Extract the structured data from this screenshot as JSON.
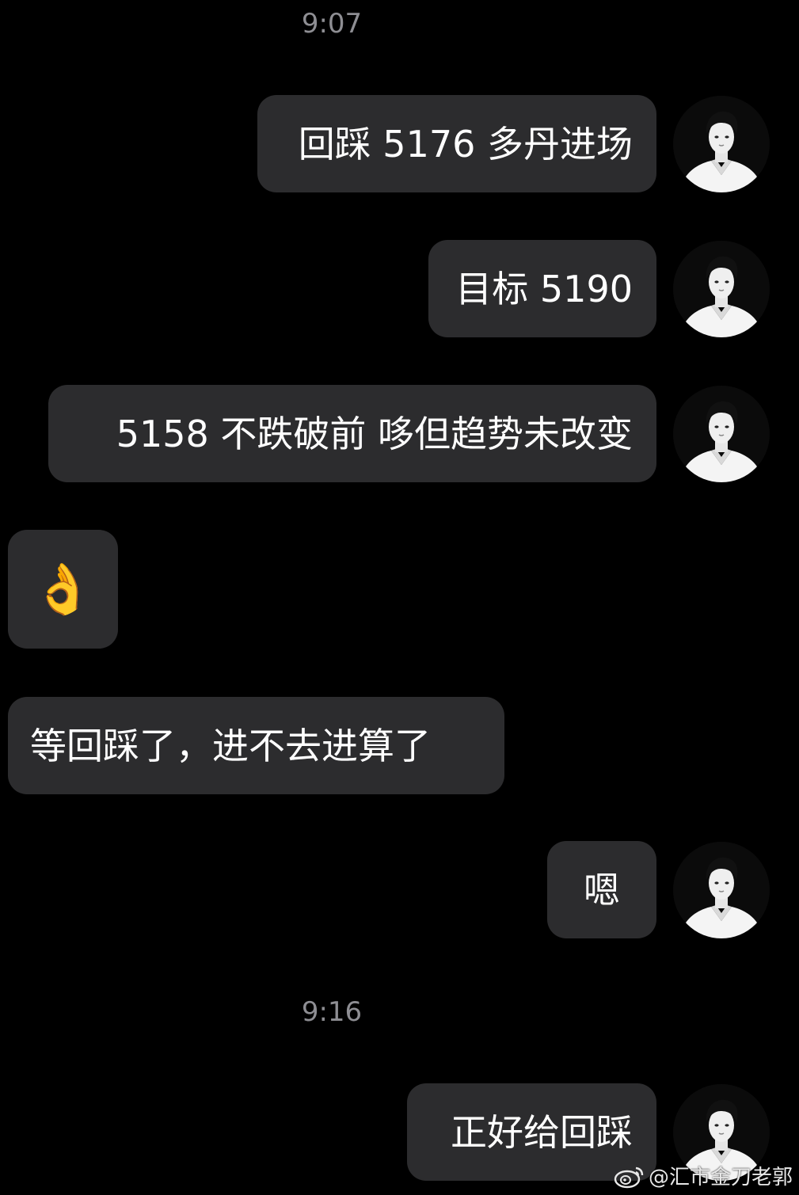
{
  "timestamps": [
    "9:07",
    "9:16"
  ],
  "messages": [
    {
      "text": "回踩 5176 多丹进场",
      "side": "out"
    },
    {
      "text": "目标 5190",
      "side": "out"
    },
    {
      "text": "5158 不跌破前 哆但趋势未改变",
      "side": "out"
    },
    {
      "text": "👌",
      "side": "in"
    },
    {
      "text": "等回踩了，进不去进算了",
      "side": "in"
    },
    {
      "text": "嗯",
      "side": "out"
    },
    {
      "text": "正好给回踩",
      "side": "out"
    }
  ],
  "watermark": {
    "text": "@汇市金刀老郭",
    "icon": "weibo-logo-icon"
  },
  "colors": {
    "background": "#000000",
    "bubble": "#2c2c2e",
    "timestamp": "#8e8e93",
    "text": "#ffffff"
  }
}
